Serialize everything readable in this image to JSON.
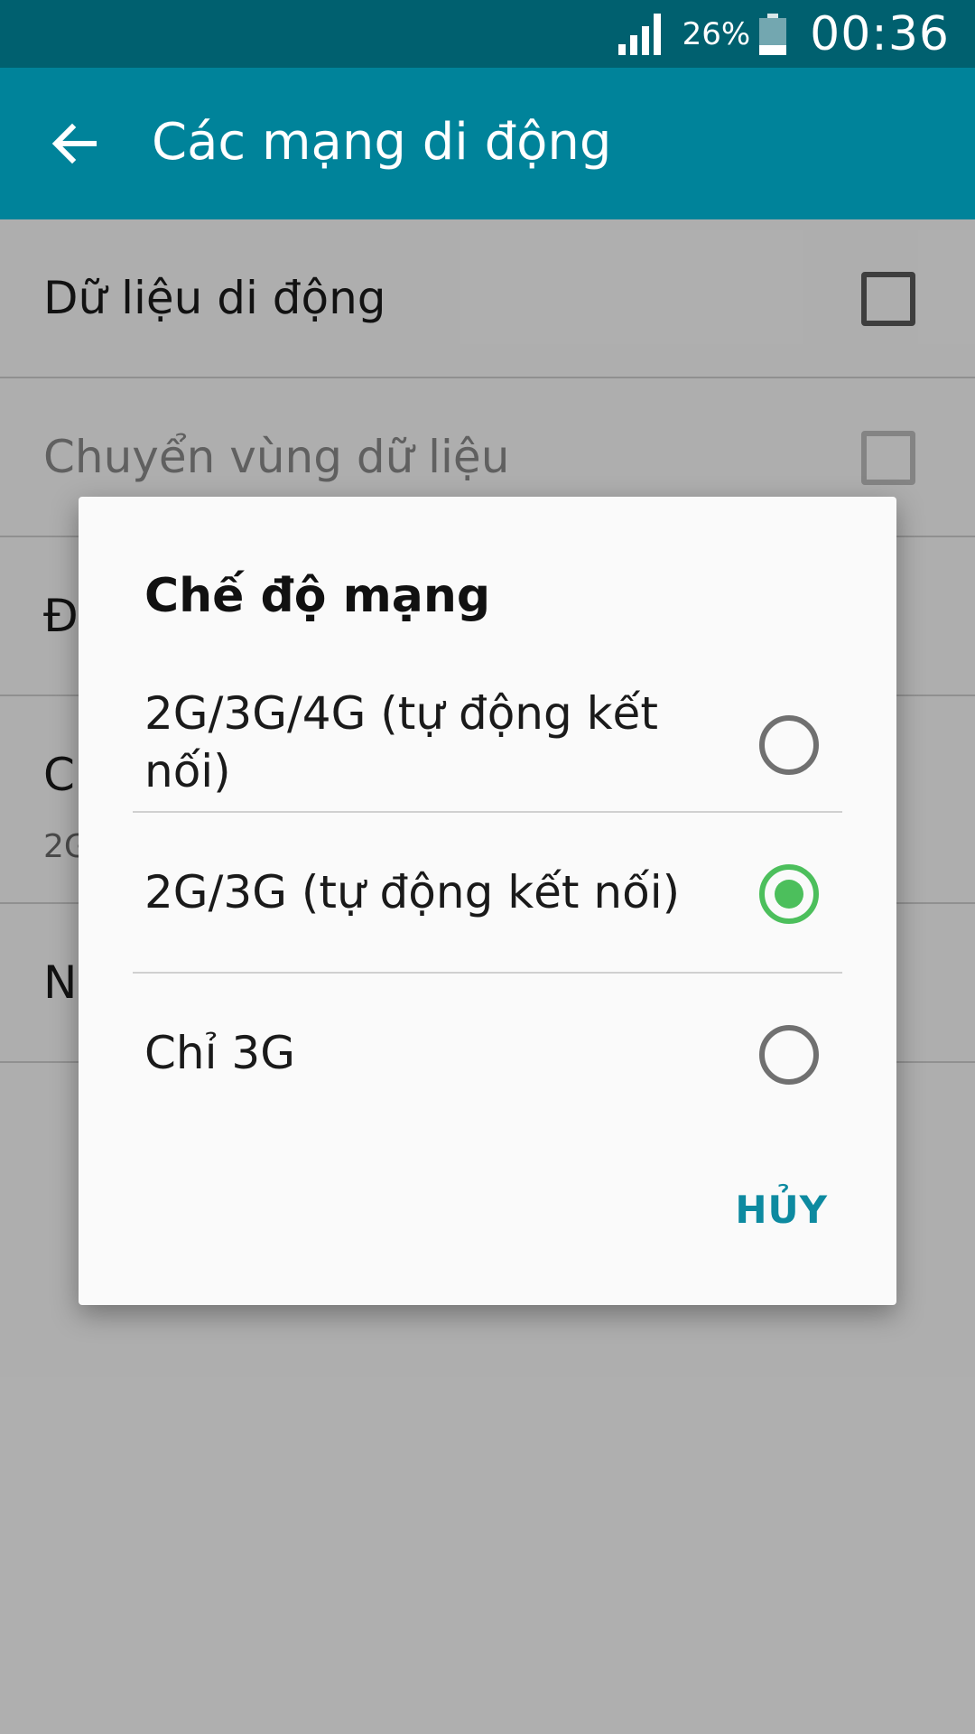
{
  "status_bar": {
    "battery_text": "26%",
    "battery_level": 0.26,
    "time": "00:36"
  },
  "app_bar": {
    "title": "Các mạng di động",
    "back_icon": "arrow-left-icon"
  },
  "settings": [
    {
      "title": "Dữ liệu di động",
      "checked": false,
      "enabled": true
    },
    {
      "title": "Chuyển vùng dữ liệu",
      "checked": false,
      "enabled": false
    },
    {
      "title": "Đ"
    },
    {
      "title": "C",
      "subtitle": "2G"
    },
    {
      "title": "N"
    }
  ],
  "dialog": {
    "title": "Chế độ mạng",
    "options": [
      {
        "label": "2G/3G/4G (tự động kết nối)",
        "selected": false
      },
      {
        "label": "2G/3G (tự động kết nối)",
        "selected": true
      },
      {
        "label": "Chỉ 3G",
        "selected": false
      }
    ],
    "cancel_label": "HỦY"
  },
  "colors": {
    "status_bar": "#00606f",
    "app_bar": "#00839a",
    "radio_selected": "#4cbf5c",
    "accent": "#0d8aa0"
  }
}
